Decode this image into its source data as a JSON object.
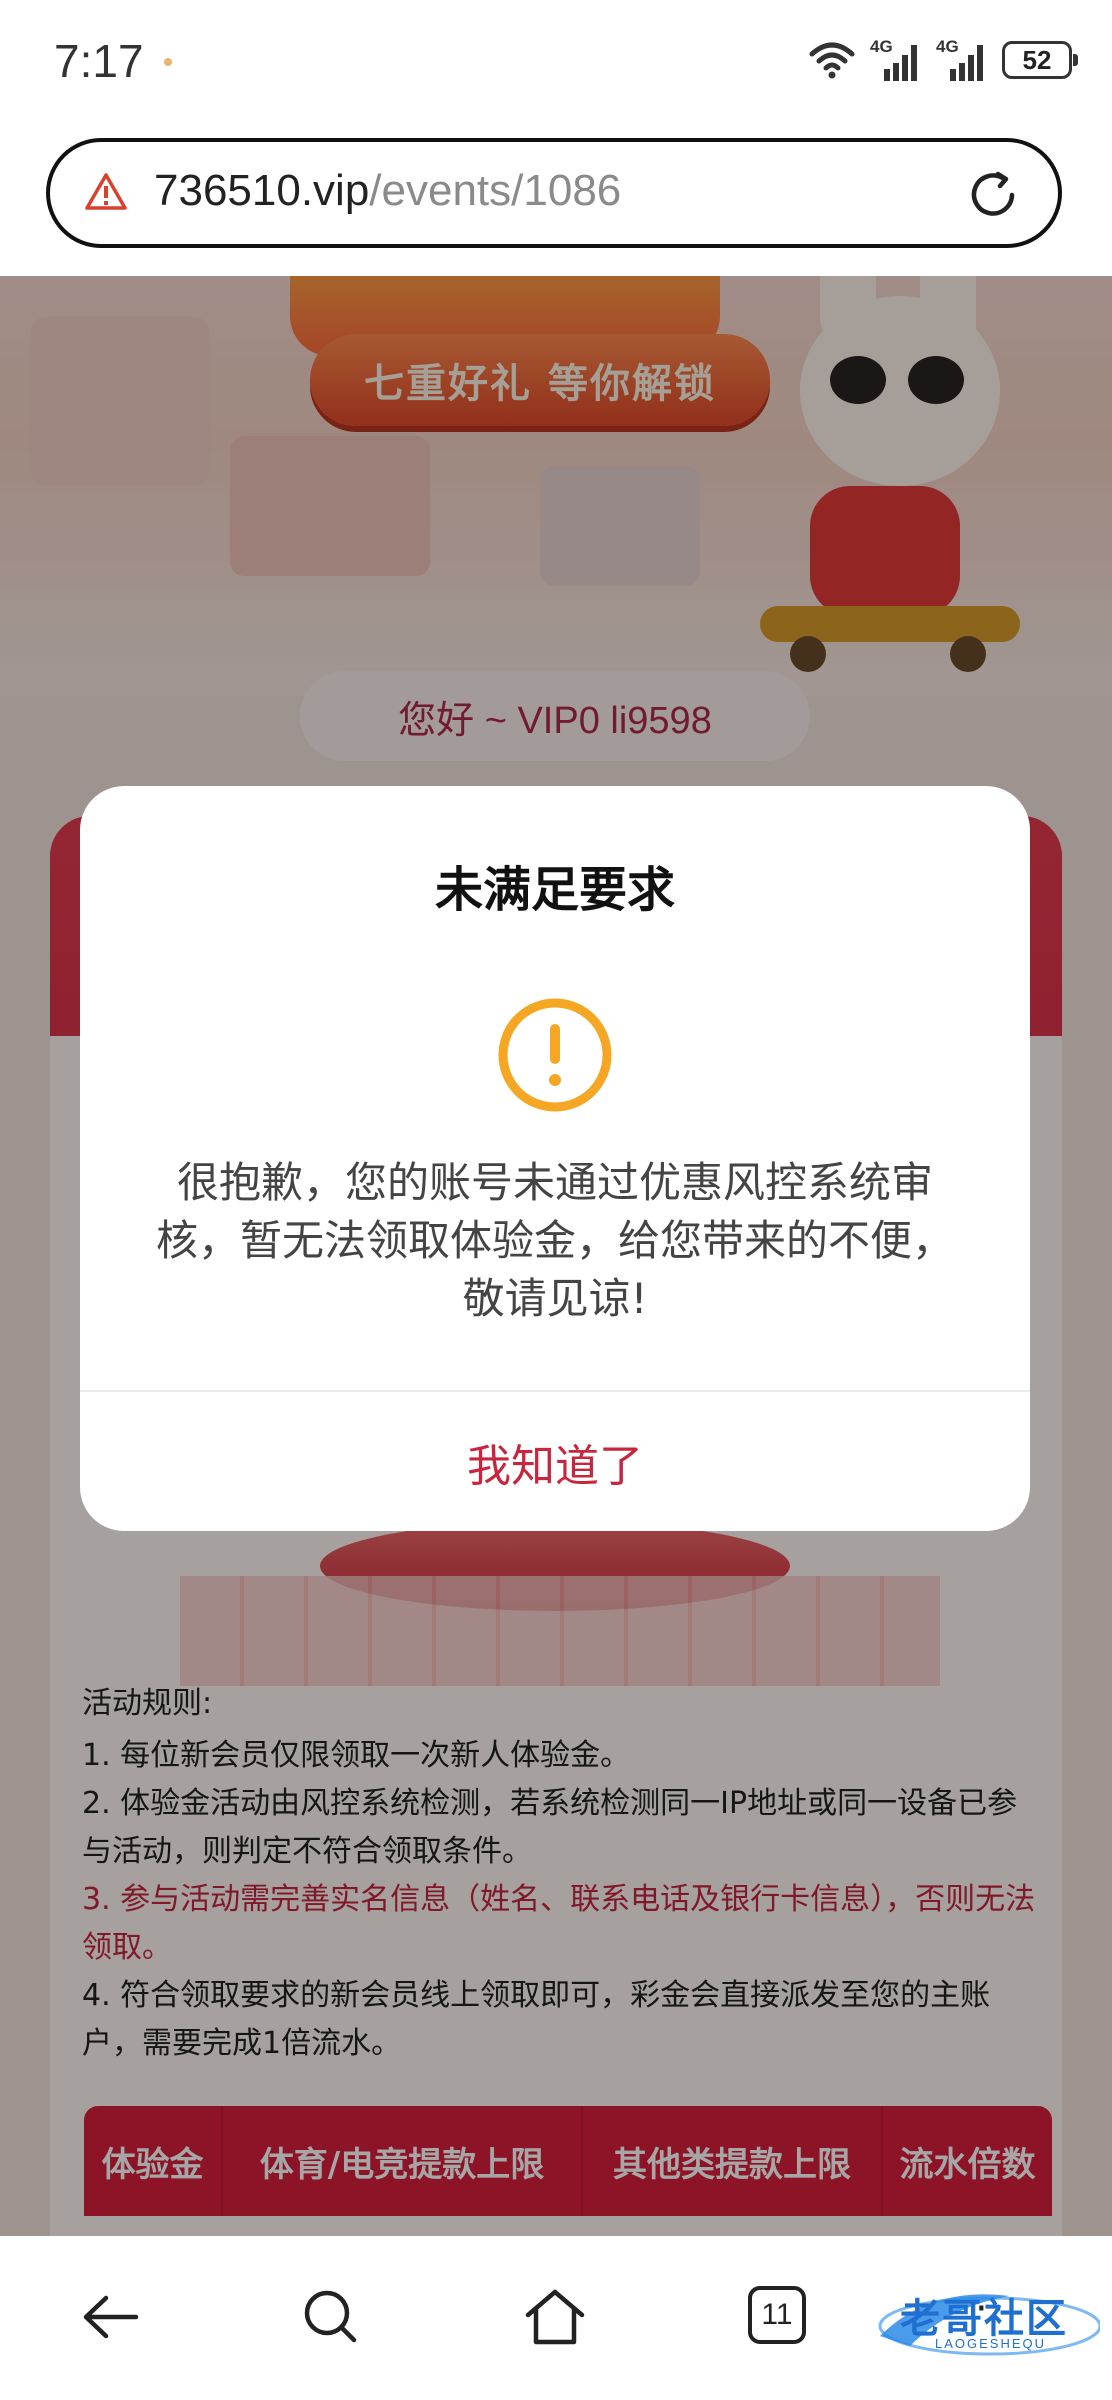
{
  "status_bar": {
    "time": "7:17",
    "net1": "4G",
    "net2": "4G",
    "battery": "52"
  },
  "browser": {
    "url_host": "736510.vip",
    "url_path": "/events/1086"
  },
  "page": {
    "banner_ribbon": "七重好礼 等你解锁",
    "greeting": "您好 ~ VIP0 li9598",
    "rules_title": "活动规则:",
    "rules": [
      "1. 每位新会员仅限领取一次新人体验金。",
      "2. 体验金活动由风控系统检测，若系统检测同一IP地址或同一设备已参与活动，则判定不符合领取条件。",
      "3. 参与活动需完善实名信息（姓名、联系电话及银行卡信息），否则无法领取。",
      "4. 符合领取要求的新会员线上领取即可，彩金会直接派发至您的主账户，需要完成1倍流水。"
    ],
    "table_headers": [
      "体验金",
      "体育/电竞提款上限",
      "其他类提款上限",
      "流水倍数"
    ]
  },
  "modal": {
    "title": "未满足要求",
    "message": "很抱歉，您的账号未通过优惠风控系统审核，暂无法领取体验金，给您带来的不便，敬请见谅!",
    "button": "我知道了"
  },
  "nav": {
    "tab_count": "11",
    "watermark": "老哥社区",
    "watermark_sub": "LAOGESHEQU"
  },
  "colors": {
    "accent_red": "#c7263e",
    "warning_orange": "#f5a623"
  }
}
